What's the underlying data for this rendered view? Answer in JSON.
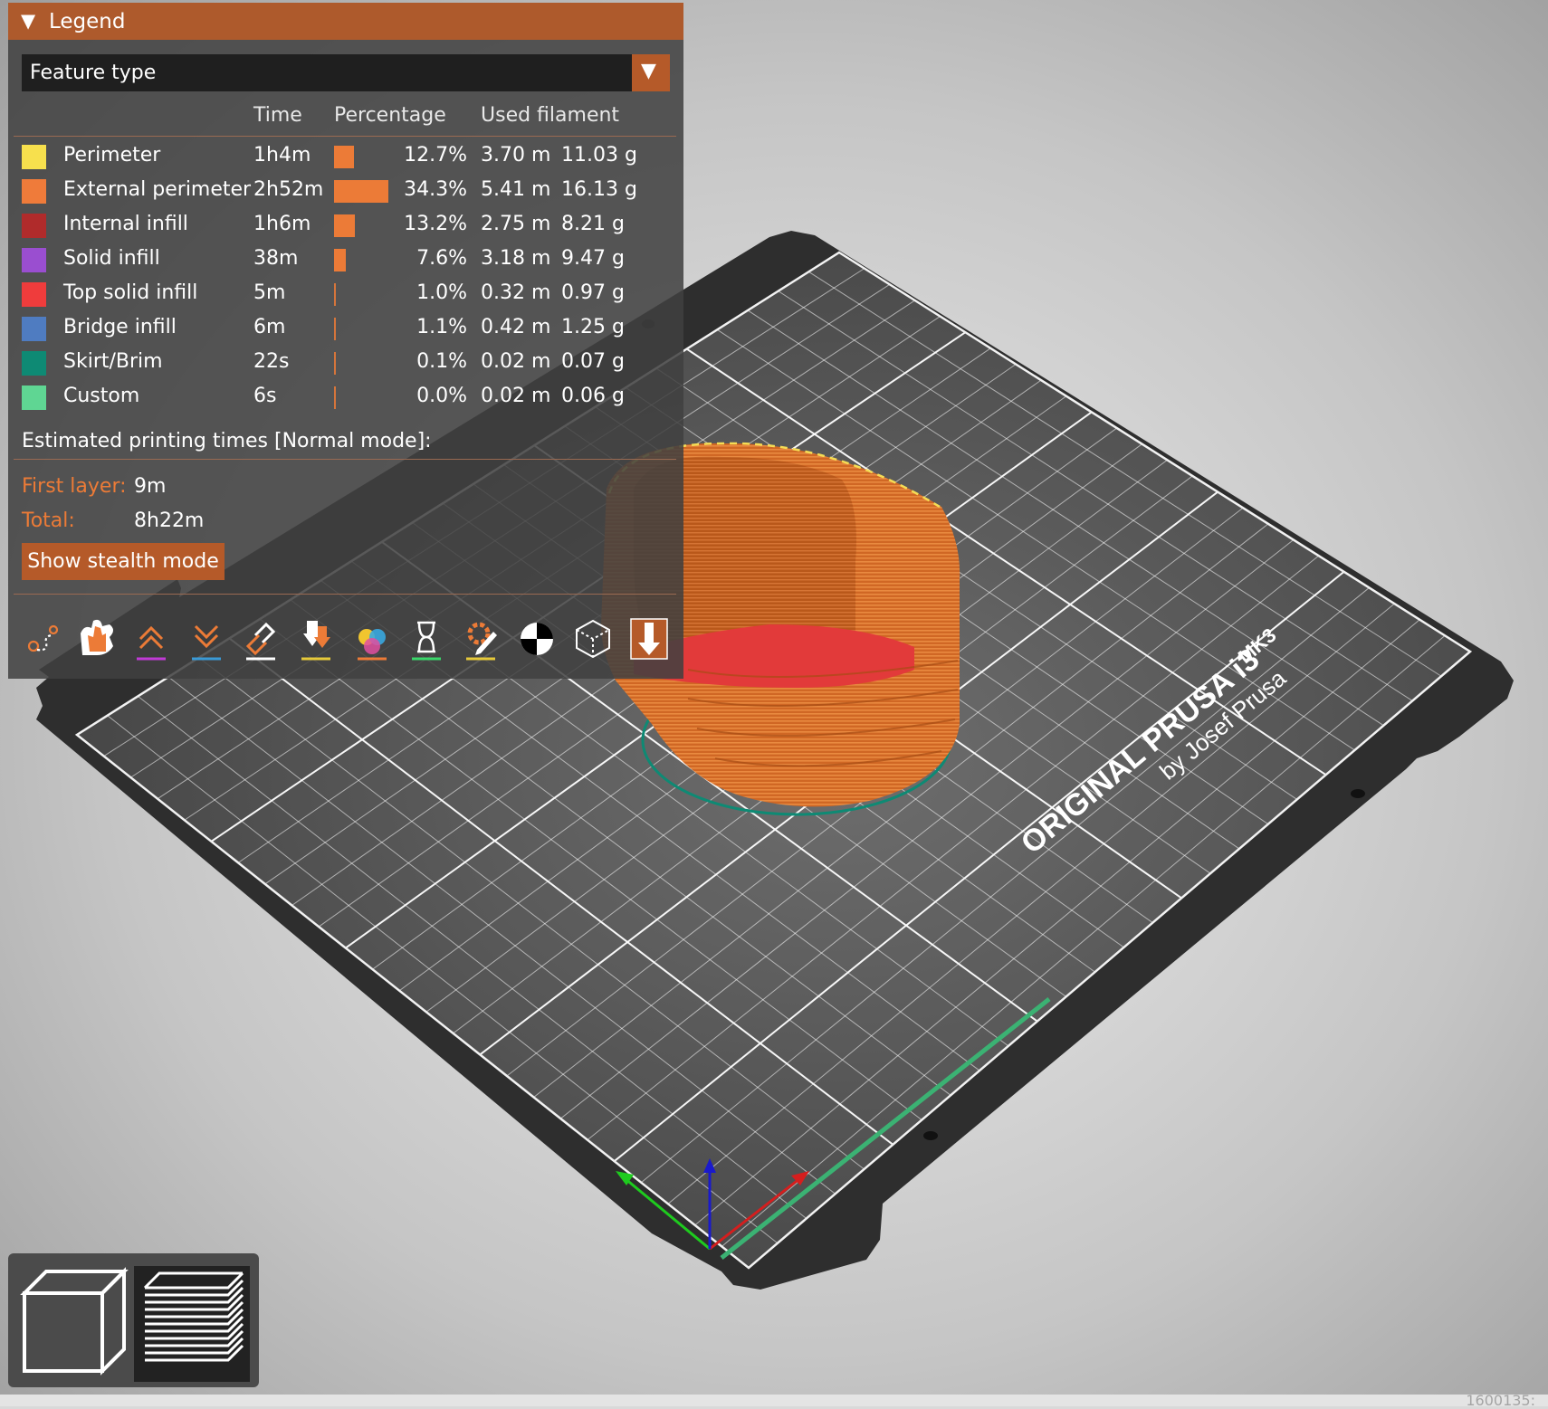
{
  "legend": {
    "title": "Legend",
    "collapse_glyph": "▼",
    "view_type": "Feature type",
    "dropdown_glyph": "▼",
    "columns": {
      "time": "Time",
      "percentage": "Percentage",
      "used_filament": "Used filament"
    },
    "features": [
      {
        "name": "Perimeter",
        "color": "#f7e04d",
        "time": "1h4m",
        "share": 0.127,
        "percentage": "12.7%",
        "length": "3.70 m",
        "weight": "11.03 g"
      },
      {
        "name": "External perimeter",
        "color": "#ef7b3a",
        "time": "2h52m",
        "share": 0.343,
        "percentage": "34.3%",
        "length": "5.41 m",
        "weight": "16.13 g"
      },
      {
        "name": "Internal infill",
        "color": "#b02b2b",
        "time": "1h6m",
        "share": 0.132,
        "percentage": "13.2%",
        "length": "2.75 m",
        "weight": "8.21 g"
      },
      {
        "name": "Solid infill",
        "color": "#9a4ed0",
        "time": "38m",
        "share": 0.076,
        "percentage": "7.6%",
        "length": "3.18 m",
        "weight": "9.47 g"
      },
      {
        "name": "Top solid infill",
        "color": "#ef3c3c",
        "time": "5m",
        "share": 0.01,
        "percentage": "1.0%",
        "length": "0.32 m",
        "weight": "0.97 g"
      },
      {
        "name": "Bridge infill",
        "color": "#4f7cc1",
        "time": "6m",
        "share": 0.011,
        "percentage": "1.1%",
        "length": "0.42 m",
        "weight": "1.25 g"
      },
      {
        "name": "Skirt/Brim",
        "color": "#0e8a74",
        "time": "22s",
        "share": 0.001,
        "percentage": "0.1%",
        "length": "0.02 m",
        "weight": "0.07 g"
      },
      {
        "name": "Custom",
        "color": "#5fd693",
        "time": "6s",
        "share": 0.0,
        "percentage": "0.0%",
        "length": "0.02 m",
        "weight": "0.06 g"
      }
    ],
    "estimated_title": "Estimated printing times [Normal mode]:",
    "first_layer_label": "First layer:",
    "first_layer_value": "9m",
    "total_label": "Total:",
    "total_value": "8h22m",
    "stealth_button": "Show stealth mode",
    "toolbar_icons": [
      "travel-icon",
      "retraction-icon",
      "deretraction-icon",
      "layer-up-icon",
      "layer-down-icon",
      "seams-icon",
      "tool-change-icon",
      "color-change-icon",
      "pause-icon",
      "custom-gcode-icon",
      "center-of-gravity-icon",
      "shells-icon",
      "tool-marker-icon"
    ]
  },
  "bed": {
    "brand_line1": "ORIGINAL PRUSA i3",
    "brand_model": "MK3",
    "brand_line2": "by Josef Prusa"
  },
  "view_switch": {
    "items": [
      "3d-view",
      "preview"
    ],
    "active": "preview"
  },
  "status": {
    "text": "1600135:"
  }
}
